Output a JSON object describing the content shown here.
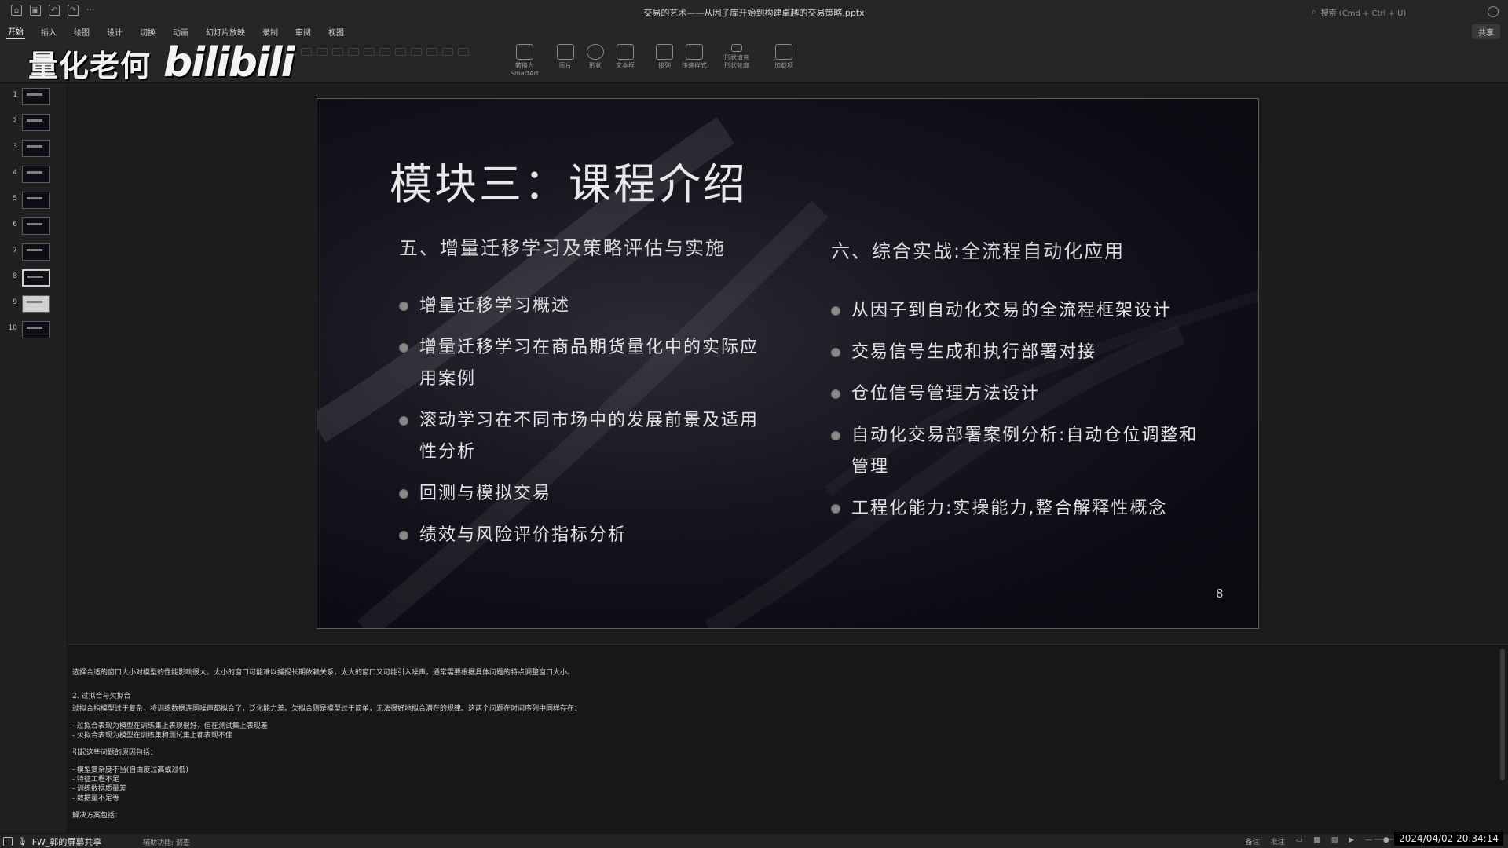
{
  "window": {
    "doc_title": "交易的艺术——从因子库开始到构建卓越的交易策略.pptx",
    "search_placeholder": "搜索 (Cmd + Ctrl + U)"
  },
  "ribbon": {
    "tabs": [
      "开始",
      "插入",
      "绘图",
      "设计",
      "切换",
      "动画",
      "幻灯片放映",
      "录制",
      "审阅",
      "视图"
    ],
    "active_tab": "开始",
    "share_label": "共享",
    "tools": [
      {
        "label": "转换为 SmartArt",
        "icon": "smartart-icon"
      },
      {
        "label": "图片",
        "icon": "picture-icon"
      },
      {
        "label": "形状",
        "icon": "shapes-icon"
      },
      {
        "label": "文本框",
        "icon": "textbox-icon"
      },
      {
        "label": "排列",
        "icon": "arrange-icon"
      },
      {
        "label": "快速样式",
        "icon": "quick-styles-icon"
      },
      {
        "label": "形状填充",
        "icon": "shape-fill-icon"
      },
      {
        "label": "形状轮廓",
        "icon": "shape-outline-icon"
      },
      {
        "label": "加载项",
        "icon": "addins-icon"
      }
    ]
  },
  "watermark": {
    "channel": "量化老何",
    "platform": "bilibili"
  },
  "thumbnails": {
    "numbers": [
      "1",
      "2",
      "3",
      "4",
      "5",
      "6",
      "7",
      "8",
      "9",
      "10"
    ],
    "active": "8"
  },
  "slide": {
    "title": "模块三：课程介绍",
    "left": {
      "heading": "五、增量迁移学习及策略评估与实施",
      "items": [
        "增量迁移学习概述",
        "增量迁移学习在商品期货量化中的实际应用案例",
        "滚动学习在不同市场中的发展前景及适用性分析",
        "回测与模拟交易",
        "绩效与风险评价指标分析"
      ]
    },
    "right": {
      "heading": "六、综合实战:全流程自动化应用",
      "items": [
        "从因子到自动化交易的全流程框架设计",
        "交易信号生成和执行部署对接",
        "仓位信号管理方法设计",
        "自动化交易部署案例分析:自动仓位调整和管理",
        "工程化能力:实操能力,整合解释性概念"
      ]
    },
    "page_number": "8"
  },
  "notes": {
    "lines": [
      "选择合适的窗口大小对模型的性能影响很大。太小的窗口可能难以捕捉长期依赖关系，太大的窗口又可能引入噪声，通常需要根据具体问题的特点调整窗口大小。",
      "",
      "2. 过拟合与欠拟合",
      "过拟合指模型过于复杂，将训练数据连同噪声都拟合了，泛化能力差。欠拟合则是模型过于简单，无法很好地拟合潜在的规律。这两个问题在时间序列中同样存在：",
      "",
      "- 过拟合表现为模型在训练集上表现很好，但在测试集上表现差",
      "- 欠拟合表现为模型在训练集和测试集上都表现不佳",
      "",
      "引起这些问题的原因包括：",
      "",
      "- 模型复杂度不当(自由度过高或过低)",
      "- 特征工程不足",
      "- 训练数据质量差",
      "- 数据量不足等",
      "",
      "解决方案包括："
    ]
  },
  "statusbar": {
    "share_label": "FW_郭的屏幕共享",
    "accessibility": "辅助功能: 调查",
    "notes_btn": "备注",
    "comments_btn": "批注",
    "datetime": "2024/04/02 20:34:14"
  }
}
